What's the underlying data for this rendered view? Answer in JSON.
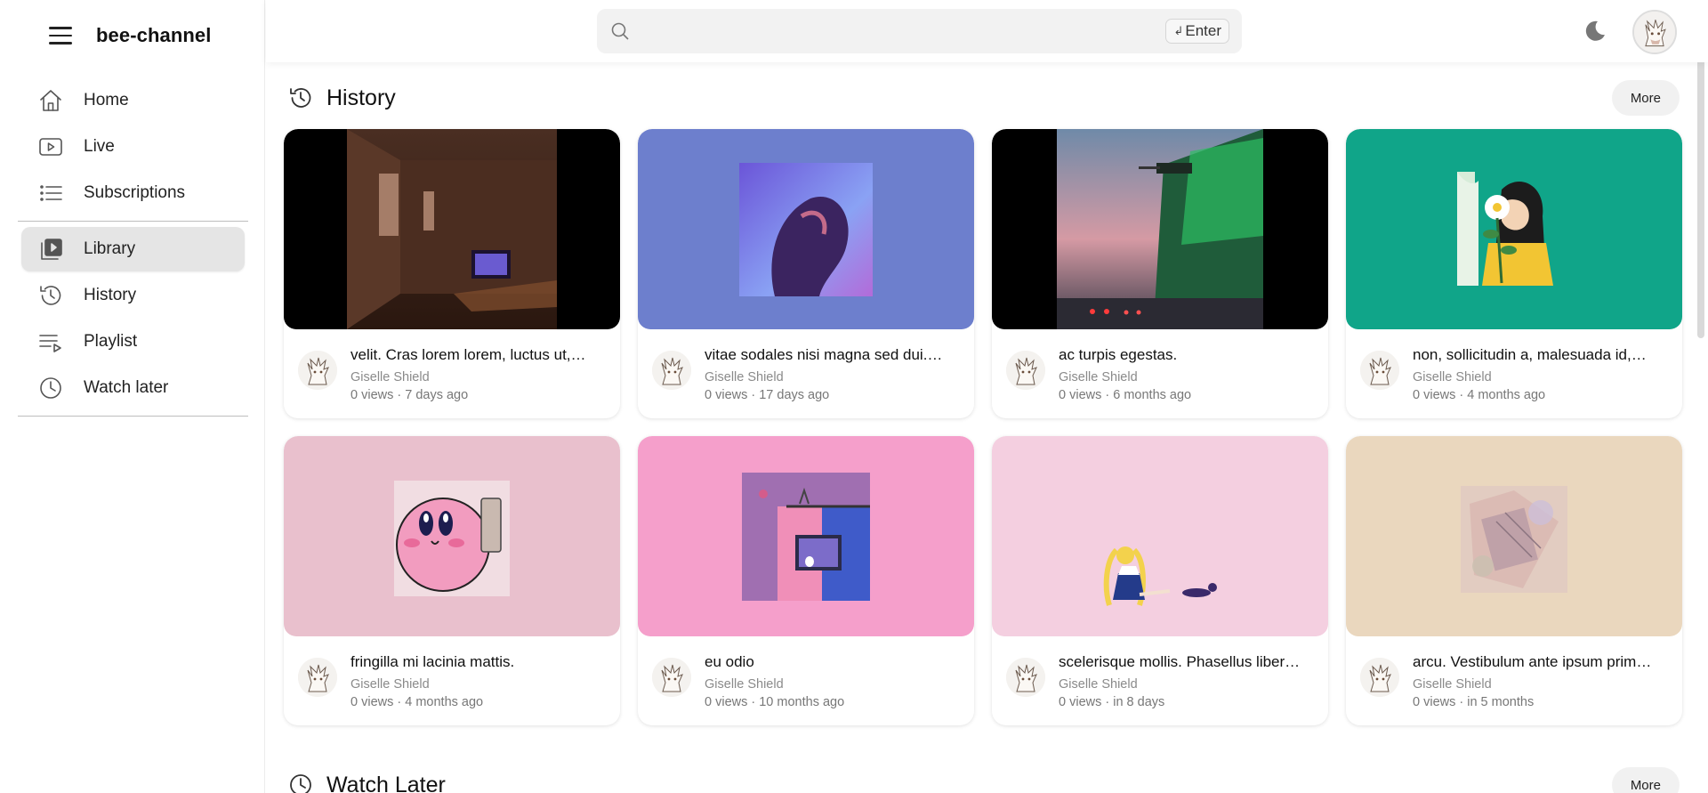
{
  "brand": {
    "name": "bee-channel"
  },
  "nav": {
    "primary": [
      {
        "label": "Home",
        "icon": "home-icon"
      },
      {
        "label": "Live",
        "icon": "live-icon"
      },
      {
        "label": "Subscriptions",
        "icon": "subscriptions-icon"
      }
    ],
    "secondary": [
      {
        "label": "Library",
        "icon": "library-icon",
        "active": true
      },
      {
        "label": "History",
        "icon": "history-icon"
      },
      {
        "label": "Playlist",
        "icon": "playlist-icon"
      },
      {
        "label": "Watch later",
        "icon": "clock-icon"
      }
    ]
  },
  "header": {
    "search_placeholder": "",
    "search_value": "",
    "enter_hint": "Enter"
  },
  "sections": {
    "history": {
      "title": "History",
      "more_label": "More"
    },
    "watch_later": {
      "title": "Watch Later",
      "more_label": "More"
    }
  },
  "videos": [
    {
      "title": "velit. Cras lorem lorem, luctus ut,…",
      "channel": "Giselle Shield",
      "stats": "0 views · 7 days ago",
      "bg": "#000000"
    },
    {
      "title": "vitae sodales nisi magna sed dui.…",
      "channel": "Giselle Shield",
      "stats": "0 views · 17 days ago",
      "bg": "#6d7fcd"
    },
    {
      "title": "ac turpis egestas.",
      "channel": "Giselle Shield",
      "stats": "0 views · 6 months ago",
      "bg": "#000000"
    },
    {
      "title": "non, sollicitudin a, malesuada id,…",
      "channel": "Giselle Shield",
      "stats": "0 views · 4 months ago",
      "bg": "#10a589"
    },
    {
      "title": "fringilla mi lacinia mattis.",
      "channel": "Giselle Shield",
      "stats": "0 views · 4 months ago",
      "bg": "#e9c0cd"
    },
    {
      "title": "eu odio",
      "channel": "Giselle Shield",
      "stats": "0 views · 10 months ago",
      "bg": "#f59fcb"
    },
    {
      "title": "scelerisque mollis. Phasellus liber…",
      "channel": "Giselle Shield",
      "stats": "0 views · in 8 days",
      "bg": "#f4cfe0"
    },
    {
      "title": "arcu. Vestibulum ante ipsum prim…",
      "channel": "Giselle Shield",
      "stats": "0 views · in 5 months",
      "bg": "#ead7be"
    }
  ]
}
